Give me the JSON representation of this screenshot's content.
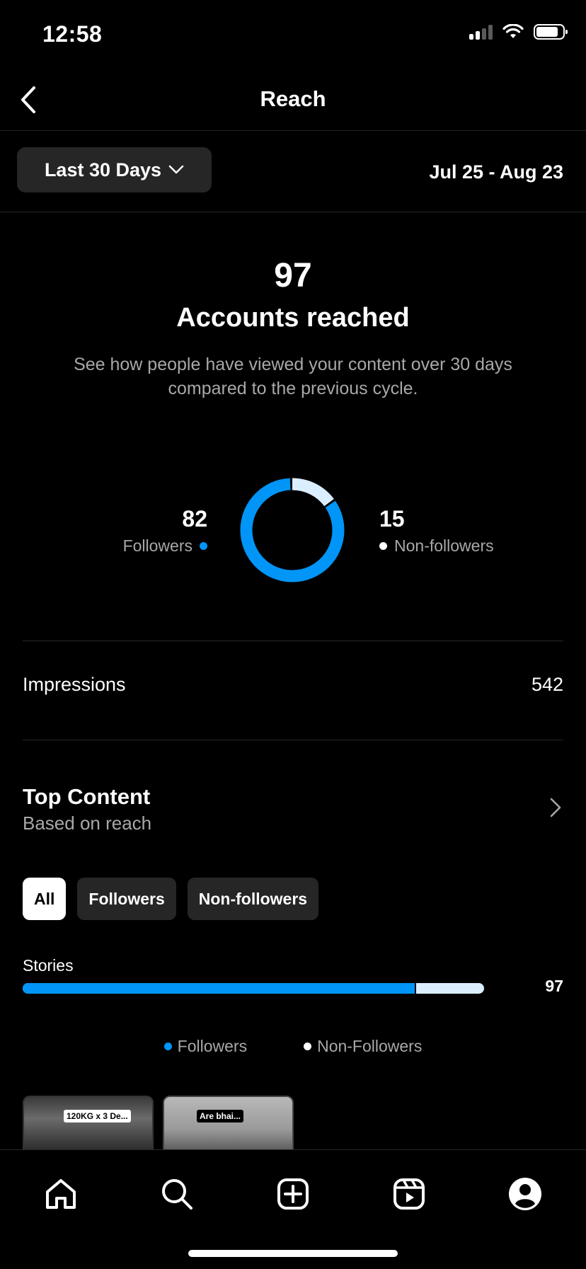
{
  "status_bar": {
    "time": "12:58"
  },
  "header": {
    "title": "Reach"
  },
  "filter": {
    "range_label": "Last 30 Days",
    "date_range": "Jul 25 - Aug 23"
  },
  "summary": {
    "count": "97",
    "label": "Accounts reached",
    "description": "See how people have viewed your content over 30 days compared to the previous cycle."
  },
  "breakdown": {
    "followers_count": "82",
    "followers_label": "Followers",
    "nonfollowers_count": "15",
    "nonfollowers_label": "Non-followers",
    "followers_fraction": 0.845,
    "colors": {
      "followers": "#0095f6",
      "nonfollowers": "#dbeeff"
    }
  },
  "impressions": {
    "label": "Impressions",
    "value": "542"
  },
  "top_content": {
    "title": "Top Content",
    "subtitle": "Based on reach",
    "chips": [
      "All",
      "Followers",
      "Non-followers"
    ],
    "active_chip": "All",
    "stories_label": "Stories",
    "stories_value": "97",
    "stories_followers_fraction": 0.85,
    "legend": [
      "Followers",
      "Non-Followers"
    ],
    "thumbnails": [
      {
        "caption": "120KG x 3 De..."
      },
      {
        "caption": "Are bhai..."
      }
    ]
  },
  "tab_bar": {
    "icons": [
      "home-icon",
      "search-icon",
      "create-icon",
      "reels-icon",
      "profile-icon"
    ]
  }
}
